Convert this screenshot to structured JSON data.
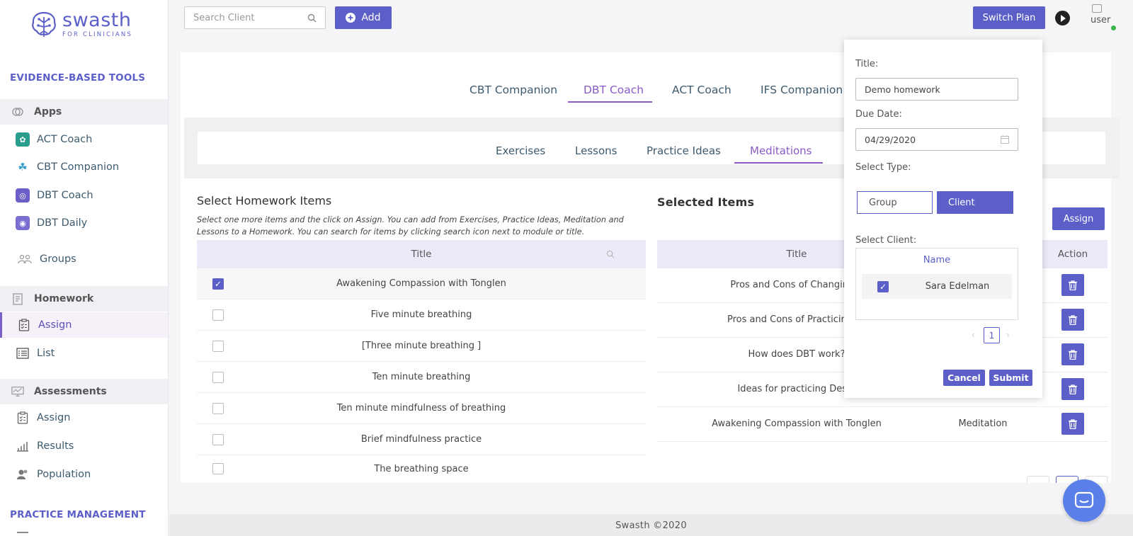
{
  "brand": {
    "name": "swasth",
    "tagline": "FOR CLINICIANS",
    "color": "#5b5fc7"
  },
  "sidebar": {
    "section1": "EVIDENCE-BASED TOOLS",
    "apps_label": "Apps",
    "apps": [
      {
        "label": "ACT Coach",
        "icon": "act-coach-icon"
      },
      {
        "label": "CBT Companion",
        "icon": "cbt-companion-icon"
      },
      {
        "label": "DBT Coach",
        "icon": "dbt-coach-icon"
      },
      {
        "label": "DBT Daily",
        "icon": "dbt-daily-icon"
      }
    ],
    "groups": "Groups",
    "homework_label": "Homework",
    "homework": [
      {
        "label": "Assign"
      },
      {
        "label": "List"
      }
    ],
    "assessments_label": "Assessments",
    "assessments": [
      {
        "label": "Assign"
      },
      {
        "label": "Results"
      },
      {
        "label": "Population"
      }
    ],
    "section2": "PRACTICE MANAGEMENT"
  },
  "topbar": {
    "search_placeholder": "Search Client",
    "add_label": "Add",
    "switch_plan": "Switch Plan",
    "user_alt": "user"
  },
  "app_tabs": [
    "CBT Companion",
    "DBT Coach",
    "ACT Coach",
    "IFS Companion"
  ],
  "active_app_tab": "DBT Coach",
  "module_tabs": [
    "Exercises",
    "Lessons",
    "Practice Ideas",
    "Meditations"
  ],
  "active_module_tab": "Meditations",
  "homework": {
    "title": "Select Homework Items",
    "description": "Select one more items and the click on Assign. You can add from Exercises, Practice Ideas, Meditation and Lessons to a Homework. You can search for items by clicking search icon next to module or title.",
    "col_title": "Title",
    "items": [
      {
        "title": "Awakening Compassion with Tonglen",
        "checked": true
      },
      {
        "title": "Five minute breathing",
        "checked": false
      },
      {
        "title": "[Three minute breathing ]",
        "checked": false
      },
      {
        "title": "Ten minute breathing",
        "checked": false
      },
      {
        "title": "Ten minute mindfulness of breathing",
        "checked": false
      },
      {
        "title": "Brief mindfulness practice",
        "checked": false
      },
      {
        "title": "The breathing space",
        "checked": false
      }
    ]
  },
  "selected": {
    "title": "Selected Items",
    "assign_label": "Assign",
    "col_title": "Title",
    "col_action": "Action",
    "rows": [
      {
        "title": "Pros and Cons of Changing E",
        "type": ""
      },
      {
        "title": "Pros and Cons of Practicing Mi",
        "type": ""
      },
      {
        "title": "How does DBT work?",
        "type": ""
      },
      {
        "title": "Ideas for practicing Descr",
        "type": ""
      },
      {
        "title": "Awakening Compassion with Tonglen",
        "type": "Meditation"
      }
    ]
  },
  "popup": {
    "title_label": "Title:",
    "title_value": "Demo homework",
    "due_label": "Due Date:",
    "due_value": "04/29/2020",
    "type_label": "Select Type:",
    "type_group": "Group",
    "type_client": "Client",
    "client_label": "Select Client:",
    "name_col": "Name",
    "client_name": "Sara Edelman",
    "page": "1",
    "cancel": "Cancel",
    "submit": "Submit"
  },
  "footer": "Swasth ©2020"
}
